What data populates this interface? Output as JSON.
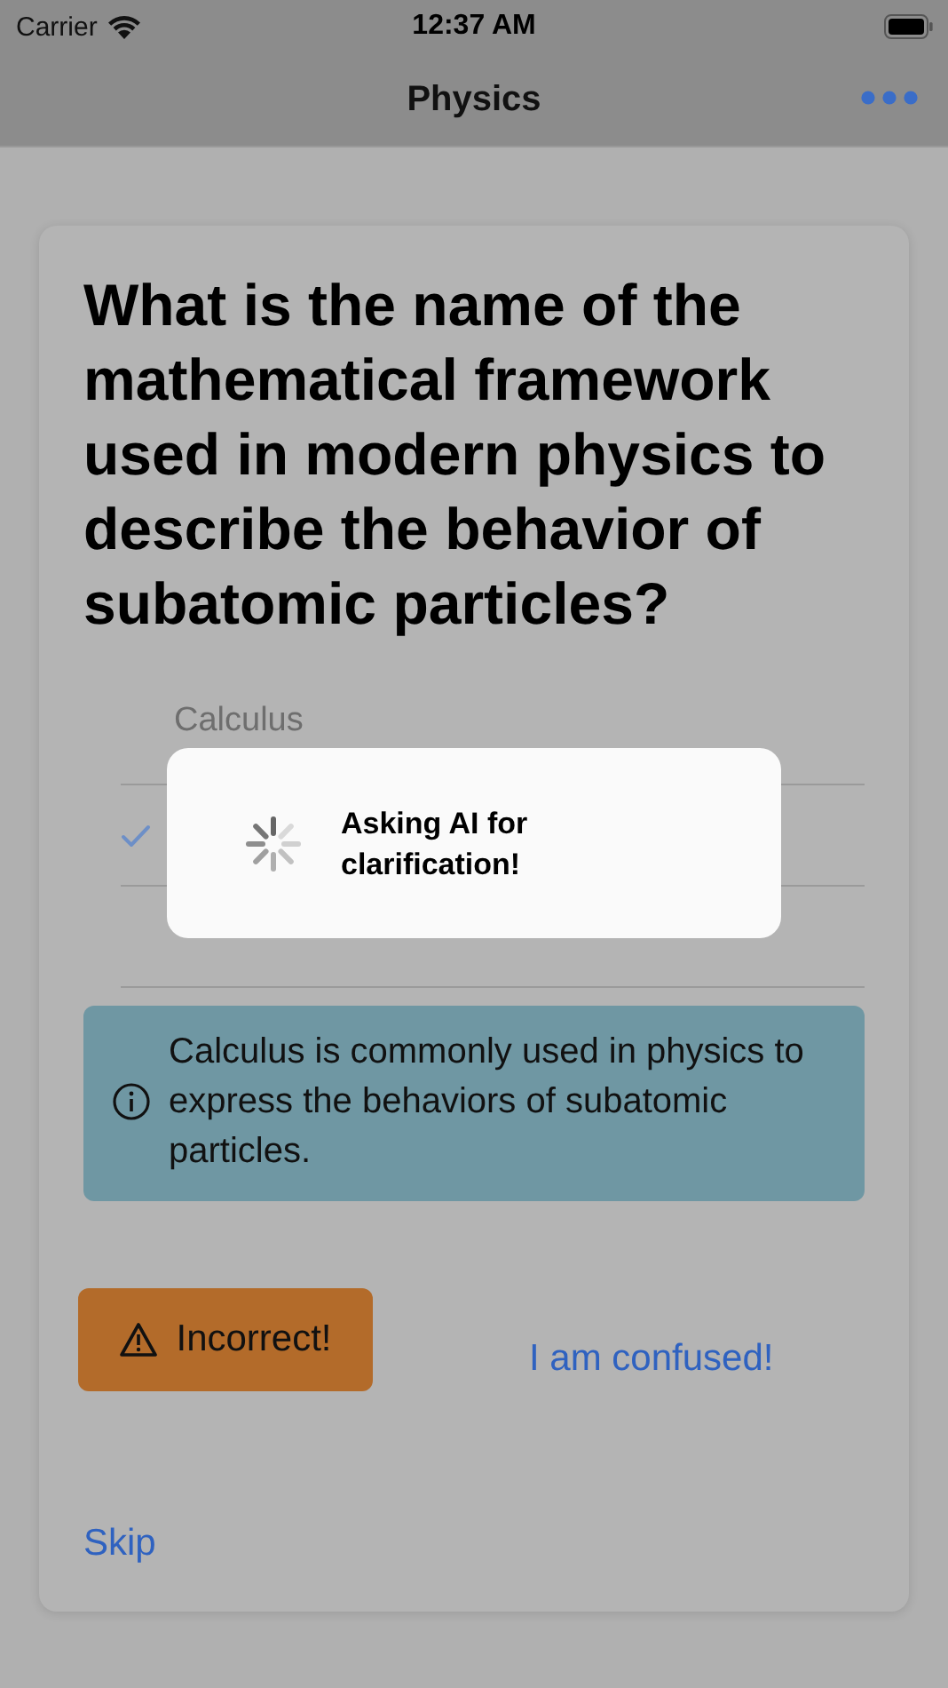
{
  "status_bar": {
    "carrier": "Carrier",
    "time": "12:37 AM"
  },
  "nav_bar": {
    "title": "Physics"
  },
  "question": "What is the name of the mathematical framework used in modern physics to describe the behavior of subatomic particles?",
  "options": [
    {
      "label": "Calculus",
      "selected": false
    },
    {
      "selected": true
    },
    {
      "selected": false
    }
  ],
  "explanation": "Calculus is commonly used in physics to express the behaviors of subatomic particles.",
  "result_button": "Incorrect!",
  "confused_link": "I am confused!",
  "skip_link": "Skip",
  "loading_hud": {
    "message": "Asking AI for clarification!"
  }
}
